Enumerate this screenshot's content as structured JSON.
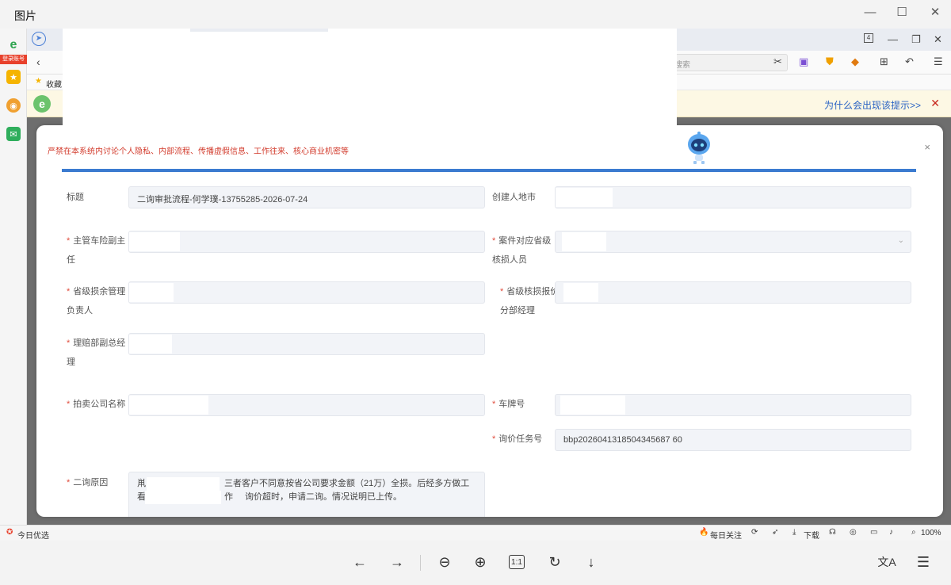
{
  "viewer": {
    "title": "图片",
    "controls": {
      "minimize": "—",
      "maximize": "☐",
      "close": "✕"
    },
    "toolbar": {
      "prev": "←",
      "next": "→",
      "zoom_out": "⊖",
      "zoom_in": "⊕",
      "actual_size": "1:1",
      "rotate": "↻",
      "download": "↓",
      "translate": "文A",
      "ocr": "☰"
    }
  },
  "browser": {
    "login_badge": "登录账号",
    "tab_count": "4",
    "search_placeholder": "搜索",
    "favorites_label": "收藏",
    "notice_link": "为什么会出现该提示>>",
    "notice_close": "✕",
    "status_left": "今日优选",
    "status_right": {
      "daily_follow": "每日关注",
      "download": "下载",
      "zoom": "100%"
    },
    "colors": {
      "accent_red": "#e8412c",
      "notice_bg": "#fdf8e4",
      "link_blue": "#2a63c4"
    }
  },
  "dialog": {
    "warning_text": "严禁在本系统内讨论个人隐私、内部流程、传播虚假信息、工作往来、核心商业机密等",
    "close": "×",
    "accent_line_color": "#3b7bd0",
    "fields": {
      "title_label": "标题",
      "title_value": "二询审批流程-何学璞-13755285-2026-07-24",
      "creator_location_label": "创建人地市",
      "manager_label": "主管车险副主任",
      "case_reviewer_label": "案件对应省级核损人员",
      "salvage_manager_label": "省级损余管理负责人",
      "appraisal_manager_label": "省级核损报价分部经理",
      "claims_deputy_label": "理赔部副总经理",
      "auction_company_label": "拍卖公司名称",
      "plate_label": "车牌号",
      "inquiry_task_label": "询价任务号",
      "inquiry_task_value": "bbp2026041318504345687 60",
      "reason_label": "二询原因",
      "reason_line1": "三者客户不同意按省公司要求金额（21万）全损。后经多方做工作",
      "reason_line2": "询价超时，申请二询。情况说明已上传。",
      "reason_prefix1": "鼡",
      "reason_prefix2": "看"
    }
  }
}
